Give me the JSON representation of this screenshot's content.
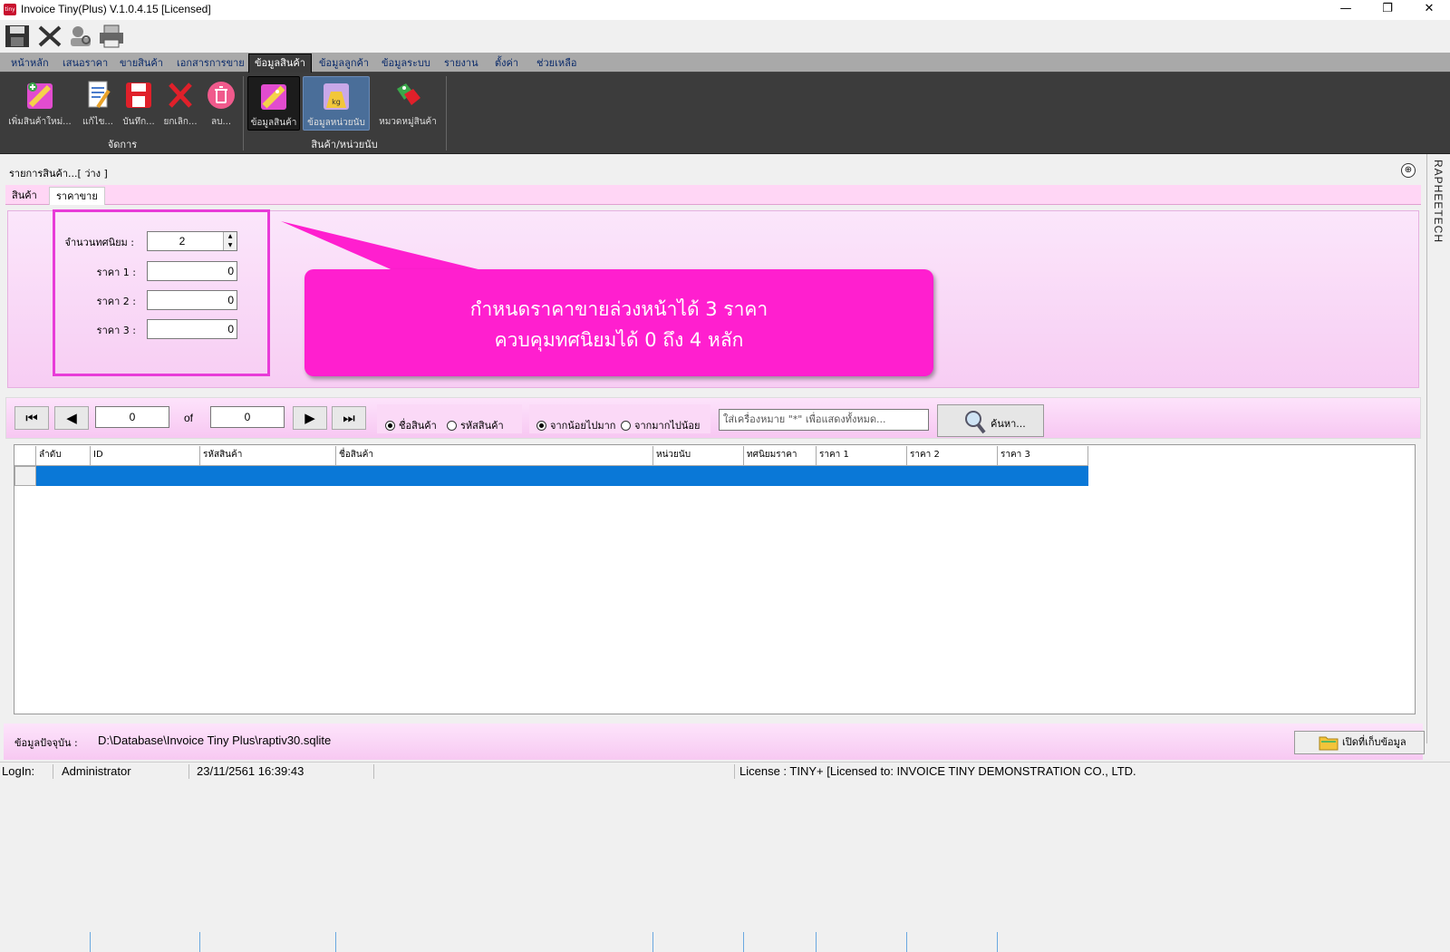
{
  "window": {
    "title": "Invoice Tiny(Plus)  V.1.0.4.15 [Licensed]",
    "app_icon_text": "tiny"
  },
  "menu": {
    "tabs": [
      {
        "label": "หน้าหลัก"
      },
      {
        "label": "เสนอราคา"
      },
      {
        "label": "ขายสินค้า"
      },
      {
        "label": "เอกสารการขาย"
      },
      {
        "label": "ข้อมูลสินค้า",
        "active": true
      },
      {
        "label": "ข้อมูลลูกค้า"
      },
      {
        "label": "ข้อมูลระบบ"
      },
      {
        "label": "รายงาน"
      },
      {
        "label": "ตั้งค่า"
      },
      {
        "label": "ช่วยเหลือ"
      }
    ]
  },
  "ribbon": {
    "group1": {
      "label": "จัดการ",
      "buttons": [
        {
          "label": "เพิ่มสินค้าใหม่..."
        },
        {
          "label": "แก้ไข..."
        },
        {
          "label": "บันทึก..."
        },
        {
          "label": "ยกเลิก..."
        },
        {
          "label": "ลบ..."
        }
      ]
    },
    "group2": {
      "label": "สินค้า/หน่วยนับ",
      "buttons": [
        {
          "label": "ข้อมูลสินค้า"
        },
        {
          "label": "ข้อมูลหน่วยนับ",
          "icon_text": "kg"
        },
        {
          "label": "หมวดหมู่สินค้า"
        }
      ]
    }
  },
  "rail_text": "RAPHEETECH",
  "panel": {
    "title": "รายการสินค้า...[ ว่าง ]",
    "collapse_symbol": "⊕",
    "tabs": [
      {
        "label": "สินค้า"
      },
      {
        "label": "ราคาขาย",
        "active": true
      }
    ],
    "fields": {
      "decimals_label": "จำนวนทศนิยม :",
      "decimals_value": "2",
      "price1_label": "ราคา 1 :",
      "price1_value": "0",
      "price2_label": "ราคา 2 :",
      "price2_value": "0",
      "price3_label": "ราคา 3 :",
      "price3_value": "0"
    },
    "callout": {
      "line1": "กำหนดราคาขายล่วงหน้าได้ 3 ราคา",
      "line2": "ควบคุมทศนิยมได้ 0 ถึง 4 หลัก"
    }
  },
  "navigator": {
    "page_value": "0",
    "of_label": "of",
    "total_value": "0",
    "search_by": [
      {
        "label": "ชื่อสินค้า",
        "checked": true
      },
      {
        "label": "รหัสสินค้า",
        "checked": false
      }
    ],
    "sort": [
      {
        "label": "จากน้อยไปมาก",
        "checked": true
      },
      {
        "label": "จากมากไปน้อย",
        "checked": false
      }
    ],
    "search_placeholder": "ใส่เครื่องหมาย \"*\" เพื่อแสดงทั้งหมด...",
    "search_button": "ค้นหา..."
  },
  "grid": {
    "columns": [
      "ลำดับ",
      "ID",
      "รหัสสินค้า",
      "ชื่อสินค้า",
      "หน่วยนับ",
      "ทศนิยมราคา",
      "ราคา 1",
      "ราคา 2",
      "ราคา 3"
    ]
  },
  "info": {
    "current_label": "ข้อมูลปัจจุบัน :",
    "current_path": "D:\\Database\\Invoice Tiny Plus\\raptiv30.sqlite",
    "open_button": "เปิดที่เก็บข้อมูล"
  },
  "status": {
    "login_label": "LogIn:",
    "user": "Administrator",
    "datetime": "23/11/2561 16:39:43",
    "license": "License : TINY+ [Licensed to: INVOICE TINY DEMONSTRATION CO., LTD."
  },
  "colors": {
    "accent_pink": "#ff1fcf",
    "highlight_border": "#e83bd8",
    "ribbon_bg": "#3c3c3c",
    "selection_blue": "#0a78d7"
  }
}
